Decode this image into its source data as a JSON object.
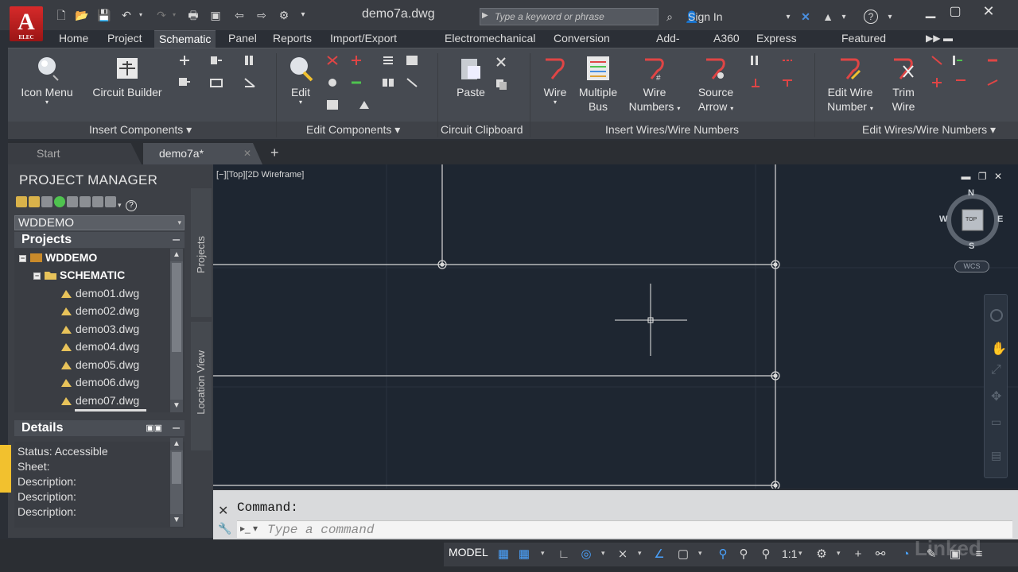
{
  "window": {
    "title": "demo7a.dwg",
    "app_logo": "A",
    "app_logo_sub": "ELEC",
    "search_placeholder": "Type a keyword or phrase",
    "sign_in": "Sign In"
  },
  "ribbon_tabs": [
    {
      "label": "Home"
    },
    {
      "label": "Project"
    },
    {
      "label": "Schematic",
      "active": true
    },
    {
      "label": "Panel"
    },
    {
      "label": "Reports"
    },
    {
      "label": "Import/Export Data"
    },
    {
      "label": "Electromechanical"
    },
    {
      "label": "Conversion Tools"
    },
    {
      "label": "Add-ins"
    },
    {
      "label": "A360"
    },
    {
      "label": "Express Tools"
    },
    {
      "label": "Featured Apps"
    }
  ],
  "ribbon": {
    "buttons": {
      "icon_menu": "Icon Menu",
      "circuit_builder": "Circuit Builder",
      "edit": "Edit",
      "paste": "Paste",
      "wire": "Wire",
      "multiple_bus_1": "Multiple",
      "multiple_bus_2": "Bus",
      "wire_numbers_1": "Wire",
      "wire_numbers_2": "Numbers",
      "source_arrow_1": "Source",
      "source_arrow_2": "Arrow",
      "edit_wire_number_1": "Edit Wire",
      "edit_wire_number_2": "Number",
      "trim_wire_1": "Trim",
      "trim_wire_2": "Wire"
    },
    "panels": {
      "insert_components": "Insert Components",
      "edit_components": "Edit Components",
      "circuit_clipboard": "Circuit Clipboard",
      "insert_wires": "Insert Wires/Wire Numbers",
      "edit_wires": "Edit Wires/Wire Numbers"
    }
  },
  "doc_tabs": {
    "start": "Start",
    "current": "demo7a*"
  },
  "project_manager": {
    "title": "PROJECT MANAGER",
    "selected_project": "WDDEMO",
    "projects_header": "Projects",
    "tree": [
      {
        "label": "WDDEMO",
        "level": 0,
        "bold": true,
        "expander": "−"
      },
      {
        "label": "SCHEMATIC",
        "level": 1,
        "bold": true,
        "expander": "−"
      },
      {
        "label": "demo01.dwg",
        "level": 2
      },
      {
        "label": "demo02.dwg",
        "level": 2
      },
      {
        "label": "demo03.dwg",
        "level": 2
      },
      {
        "label": "demo04.dwg",
        "level": 2
      },
      {
        "label": "demo05.dwg",
        "level": 2
      },
      {
        "label": "demo06.dwg",
        "level": 2
      },
      {
        "label": "demo07.dwg",
        "level": 2
      }
    ],
    "details_header": "Details",
    "details": [
      "Status: Accessible",
      "Sheet:",
      "Description:",
      "Description:",
      "Description:"
    ],
    "side_tabs": {
      "projects": "Projects",
      "location_view": "Location View"
    }
  },
  "viewport": {
    "label": "[−][Top][2D Wireframe]",
    "viewcube": {
      "n": "N",
      "s": "S",
      "e": "E",
      "w": "W",
      "face": "TOP"
    },
    "wcs": "WCS"
  },
  "command": {
    "history": "Command:",
    "placeholder": "Type a command"
  },
  "status_bar": {
    "model": "MODEL",
    "scale": "1:1"
  },
  "watermark": "Linked"
}
